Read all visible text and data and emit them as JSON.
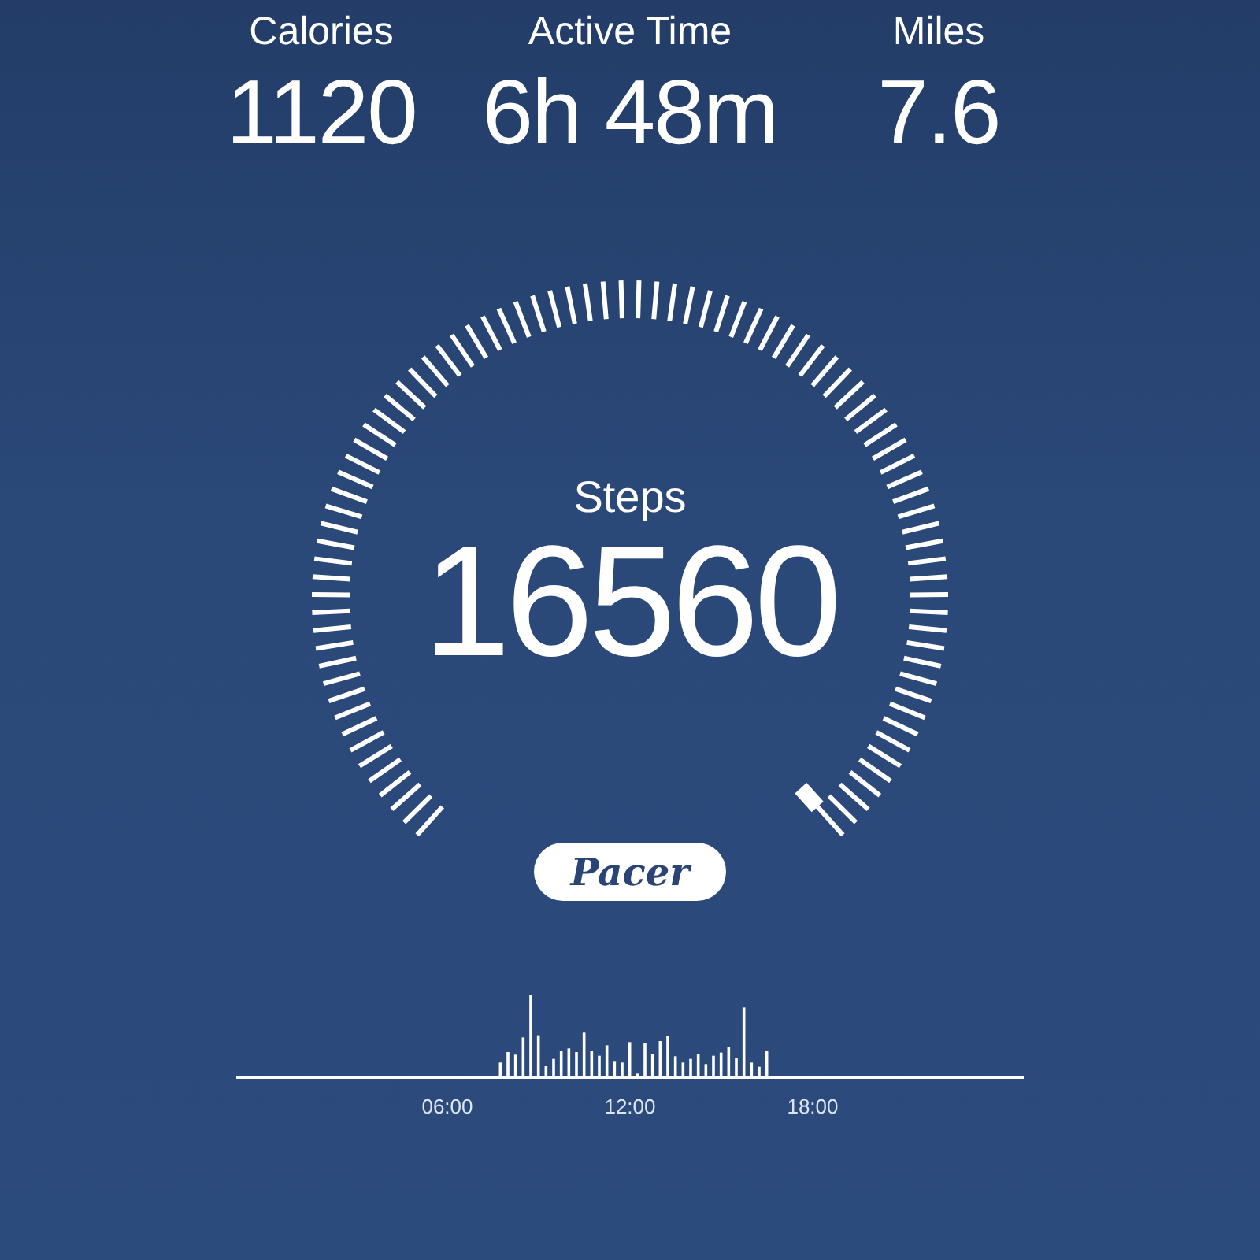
{
  "stats": [
    {
      "label": "Calories",
      "value": "1120"
    },
    {
      "label": "Active Time",
      "value": "6h 48m"
    },
    {
      "label": "Miles",
      "value": "7.6"
    }
  ],
  "gauge": {
    "label": "Steps",
    "value": "16560"
  },
  "logo": "Pacer",
  "activity_chart": {
    "x_labels": [
      "06:00",
      "12:00",
      "18:00"
    ]
  }
}
